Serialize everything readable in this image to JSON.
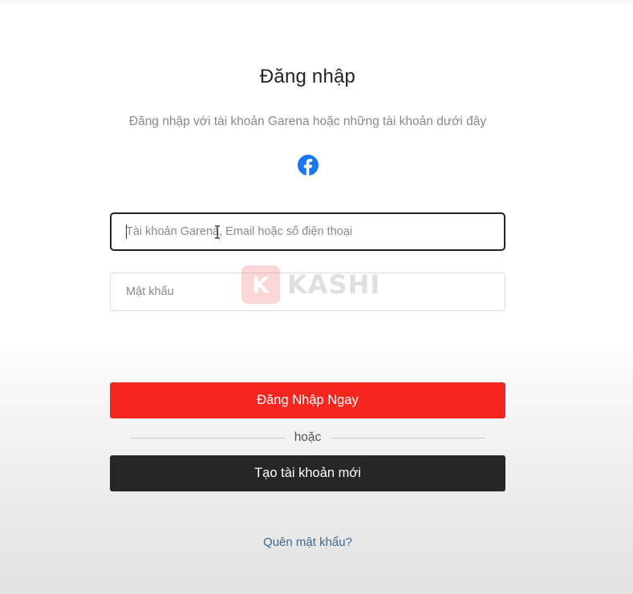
{
  "login": {
    "title": "Đăng nhập",
    "subtitle": "Đăng nhập với tài khoản Garena hoặc những tài khoản dưới đây",
    "social": {
      "provider_icon": "facebook-icon",
      "color": "#1877f2"
    },
    "username": {
      "placeholder": "Tài khoản Garena, Email hoặc số điện thoại",
      "value": ""
    },
    "password": {
      "placeholder": "Mật khẩu",
      "value": ""
    },
    "submit_label": "Đăng Nhập Ngay",
    "divider_label": "hoặc",
    "create_account_label": "Tạo tài khoản mới",
    "forgot_password_label": "Quên mật khẩu?"
  },
  "watermark": {
    "mark": "K",
    "text": "KASHI"
  },
  "colors": {
    "primary_button": "#f5261e",
    "dark_button": "#262626",
    "link": "#3b6a92",
    "focused_border": "#222222"
  }
}
